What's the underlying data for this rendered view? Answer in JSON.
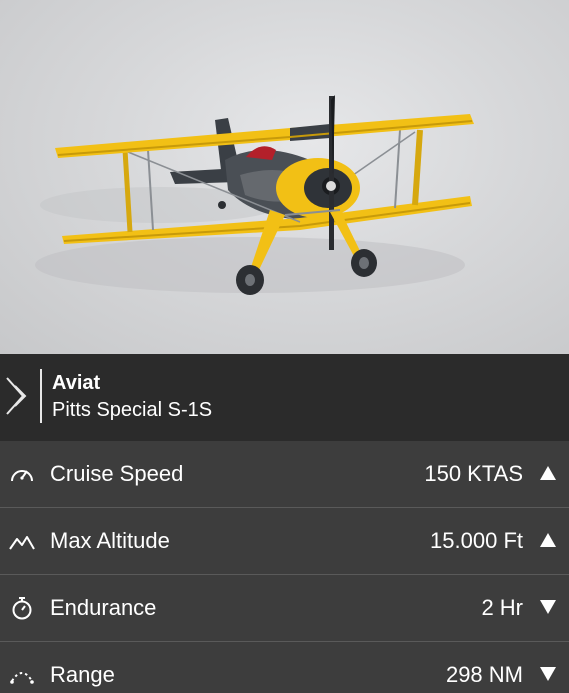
{
  "hero": {
    "image": "yellow-biplane-render"
  },
  "aircraft": {
    "manufacturer": "Aviat",
    "model": "Pitts Special S-1S"
  },
  "colors": {
    "hero_bg": "#d9dadc",
    "header_bg": "#2b2b2b",
    "rows_bg": "#3d3d3d",
    "text": "#ffffff",
    "plane_yellow": "#f2c015"
  },
  "stats": [
    {
      "label": "Cruise Speed",
      "value": "150 KTAS",
      "icon": "speedometer-icon",
      "indicator": "triangle-up"
    },
    {
      "label": "Max Altitude",
      "value": "15.000 Ft",
      "icon": "mountain-icon",
      "indicator": "triangle-up"
    },
    {
      "label": "Endurance",
      "value": "2 Hr",
      "icon": "stopwatch-icon",
      "indicator": "triangle-down"
    },
    {
      "label": "Range",
      "value": "298 NM",
      "icon": "range-arc-icon",
      "indicator": "triangle-down"
    }
  ]
}
